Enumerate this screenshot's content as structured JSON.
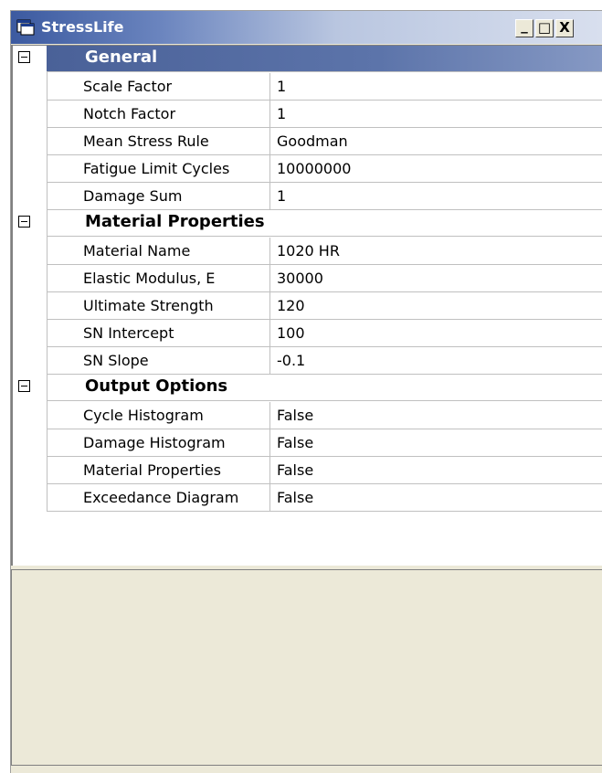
{
  "window": {
    "title": "StressLife",
    "icon": "app-window-icon",
    "controls": {
      "minimize": "_",
      "maximize": "□",
      "close": "X"
    }
  },
  "categories": [
    {
      "label": "General",
      "selected": true,
      "properties": [
        {
          "name": "Scale Factor",
          "value": "1"
        },
        {
          "name": "Notch Factor",
          "value": "1"
        },
        {
          "name": "Mean Stress Rule",
          "value": "Goodman"
        },
        {
          "name": "Fatigue Limit Cycles",
          "value": "10000000"
        },
        {
          "name": "Damage Sum",
          "value": "1"
        }
      ]
    },
    {
      "label": "Material Properties",
      "selected": false,
      "properties": [
        {
          "name": "Material Name",
          "value": "1020 HR"
        },
        {
          "name": "Elastic Modulus, E",
          "value": "30000"
        },
        {
          "name": "Ultimate Strength",
          "value": "120"
        },
        {
          "name": "SN Intercept",
          "value": "100"
        },
        {
          "name": "SN Slope",
          "value": "-0.1"
        }
      ]
    },
    {
      "label": "Output Options",
      "selected": false,
      "properties": [
        {
          "name": "Cycle Histogram",
          "value": "False"
        },
        {
          "name": "Damage Histogram",
          "value": "False"
        },
        {
          "name": "Material Properties",
          "value": "False"
        },
        {
          "name": "Exceedance Diagram",
          "value": "False"
        }
      ]
    }
  ],
  "colors": {
    "titlebar": "#3c5aa0",
    "selected_category": "#4a6198",
    "grid_line": "#c0c0c0",
    "panel_background": "#ece9d8"
  }
}
